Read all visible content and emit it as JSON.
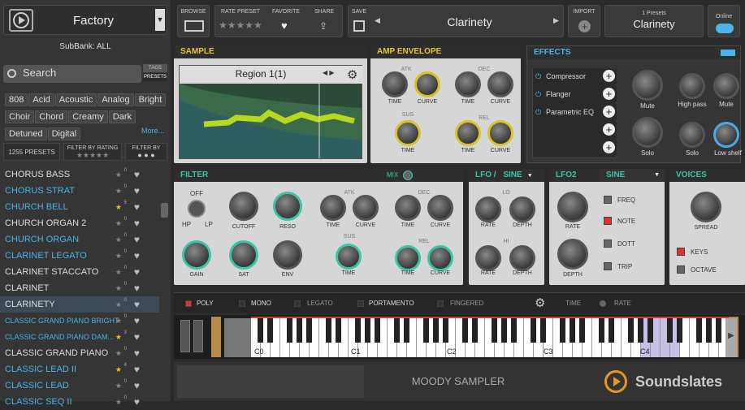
{
  "sidebar": {
    "bank": "Factory",
    "subbank": "SubBank: ALL",
    "search_placeholder": "Search",
    "tags_tab": "TAGS",
    "presets_tab": "PRESETS",
    "tags": [
      "808",
      "Acid",
      "Acoustic",
      "Analog",
      "Bright",
      "Choir",
      "Chord",
      "Creamy",
      "Dark",
      "Detuned",
      "Digital"
    ],
    "more": "More...",
    "preset_count": "1255 PRESETS",
    "filter_rating": "FILTER BY RATING",
    "filter_by": "FILTER BY",
    "presets": [
      {
        "name": "CHORUS BASS",
        "rating": "0",
        "color": "#ddd",
        "star": "n"
      },
      {
        "name": "CHORUS STRAT",
        "rating": "0",
        "color": "#4ab4e6",
        "star": "n"
      },
      {
        "name": "CHURCH BELL",
        "rating": "5",
        "color": "#4ab4e6",
        "star": "y"
      },
      {
        "name": "CHURCH ORGAN 2",
        "rating": "0",
        "color": "#ddd",
        "star": "n"
      },
      {
        "name": "CHURCH ORGAN",
        "rating": "0",
        "color": "#4ab4e6",
        "star": "n"
      },
      {
        "name": "CLARINET LEGATO",
        "rating": "0",
        "color": "#4ab4e6",
        "star": "n"
      },
      {
        "name": "CLARINET STACCATO",
        "rating": "0",
        "color": "#ddd",
        "star": "n"
      },
      {
        "name": "CLARINET",
        "rating": "0",
        "color": "#ddd",
        "star": "n"
      },
      {
        "name": "CLARINETY",
        "rating": "0",
        "color": "#ddd",
        "star": "n"
      },
      {
        "name": "CLASSIC GRAND PIANO BRIGHT",
        "rating": "0",
        "color": "#4ab4e6",
        "star": "n"
      },
      {
        "name": "CLASSIC GRAND PIANO DAM...",
        "rating": "3",
        "color": "#4ab4e6",
        "star": "y"
      },
      {
        "name": "CLASSIC GRAND PIANO",
        "rating": "0",
        "color": "#ddd",
        "star": "n"
      },
      {
        "name": "CLASSIC LEAD II",
        "rating": "4",
        "color": "#4ab4e6",
        "star": "y"
      },
      {
        "name": "CLASSIC LEAD",
        "rating": "0",
        "color": "#4ab4e6",
        "star": "n"
      },
      {
        "name": "CLASSIC SEQ II",
        "rating": "0",
        "color": "#4ab4e6",
        "star": "n"
      }
    ]
  },
  "top": {
    "browse": "BROWSE",
    "rate": "RATE PRESET",
    "favorite": "FAVORITE",
    "share": "SHARE",
    "save": "SAVE",
    "preset_name": "Clarinety",
    "import": "IMPORT",
    "presets_count": "1 Presets",
    "preset_name2": "Clarinety",
    "online": "Online"
  },
  "sample": {
    "title": "SAMPLE",
    "region": "Region 1(1)"
  },
  "amp": {
    "title": "AMP ENVELOPE",
    "atk": "ATK",
    "dec": "DEC",
    "sus": "SUS",
    "rel": "REL",
    "time": "TIME",
    "curve": "CURVE"
  },
  "effects": {
    "title": "EFFECTS",
    "items": [
      "Compressor",
      "Flanger",
      "Parametric EQ"
    ],
    "mute": "Mute",
    "highpass": "High pass",
    "solo": "Solo",
    "lowshelf": "Low shelf"
  },
  "filter": {
    "title": "FILTER",
    "mix": "MIX",
    "off": "OFF",
    "hp": "HP",
    "lp": "LP",
    "cutoff": "CUTOFF",
    "reso": "RESO",
    "gain": "GAIN",
    "sat": "SAT",
    "env": "ENV"
  },
  "lfo1": {
    "title": "LFO /",
    "wave": "SINE",
    "lo": "LO",
    "hi": "HI",
    "rate": "RATE",
    "depth": "DEPTH"
  },
  "lfo2": {
    "title": "LFO2",
    "wave": "SINE",
    "freq": "FREQ",
    "note": "NOTE",
    "dott": "DOTT",
    "trip": "TRIP",
    "rate": "RATE",
    "depth": "DEPTH"
  },
  "voices": {
    "title": "VOICES",
    "spread": "SPREAD",
    "keys": "KEYS",
    "octave": "OCTAVE"
  },
  "bar": {
    "poly": "POLY",
    "mono": "MONO",
    "legato": "LEGATO",
    "portamento": "PORTAMENTO",
    "fingered": "FINGERED",
    "time": "TIME",
    "rate": "RATE"
  },
  "keys": {
    "c0": "C0",
    "c1": "C1",
    "c2": "C2",
    "c3": "C3",
    "c4": "C4"
  },
  "footer": {
    "name": "MOODY SAMPLER",
    "brand": "Soundslates"
  }
}
